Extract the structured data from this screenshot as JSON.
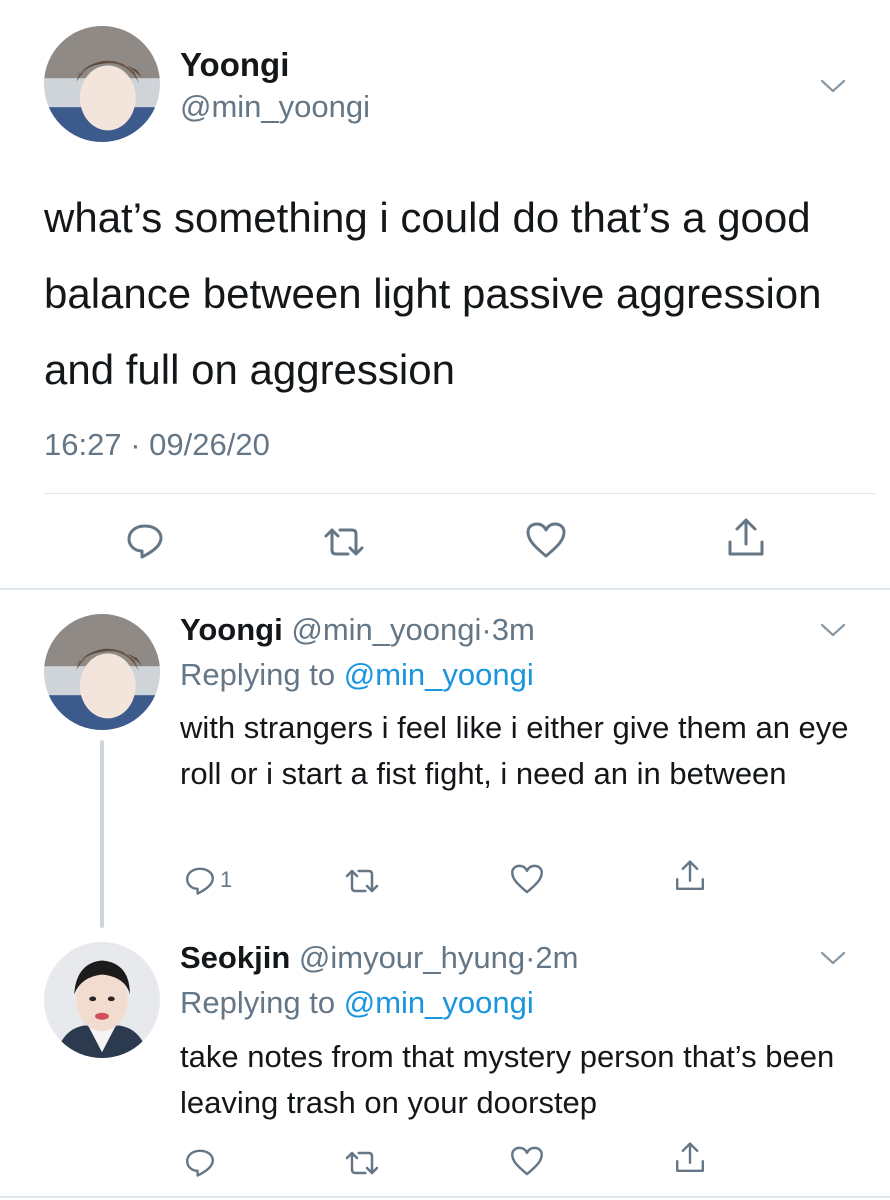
{
  "main_tweet": {
    "display_name": "Yoongi",
    "handle": "@min_yoongi",
    "text": "what’s something i could do that’s a good balance between light passive aggression and full on aggression",
    "time": "16:27",
    "separator": "·",
    "date": "09/26/20"
  },
  "replies": [
    {
      "display_name": "Yoongi",
      "handle": "@min_yoongi",
      "dot": "·",
      "age": "3m",
      "replying_label": "Replying to",
      "replying_handle": "@min_yoongi",
      "text": "with strangers i feel like i either give them an eye roll or i start a fist fight, i need an in between",
      "reply_count": "1"
    },
    {
      "display_name": "Seokjin",
      "handle": "@imyour_hyung",
      "dot": "·",
      "age": "2m",
      "replying_label": "Replying to",
      "replying_handle": "@min_yoongi",
      "text": "take notes from that mystery person that’s been leaving trash on your doorstep",
      "reply_count": ""
    }
  ],
  "icons": {
    "reply": "reply-icon",
    "retweet": "retweet-icon",
    "like": "heart-icon",
    "share": "share-icon",
    "more": "chevron-down-icon"
  },
  "colors": {
    "text": "#14171a",
    "muted": "#657786",
    "link": "#1b95e0",
    "divider": "#e1e8ed",
    "thread_line": "#ccd6dd"
  }
}
